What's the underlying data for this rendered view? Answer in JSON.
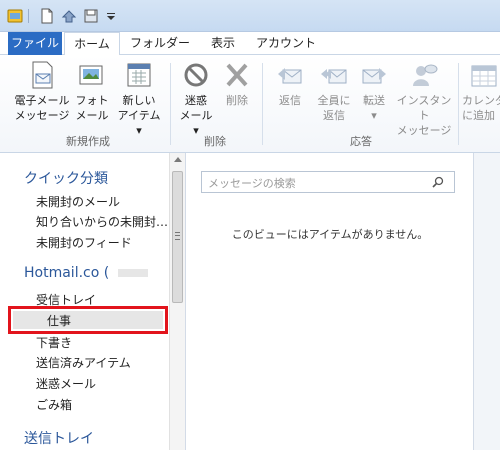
{
  "tabs": [
    {
      "id": "file",
      "label": "ファイル"
    },
    {
      "id": "home",
      "label": "ホーム"
    },
    {
      "id": "folder",
      "label": "フォルダー"
    },
    {
      "id": "view",
      "label": "表示"
    },
    {
      "id": "account",
      "label": "アカウント"
    }
  ],
  "ribbon": {
    "new_group": {
      "label": "新規作成",
      "email": "電子メール\nメッセージ",
      "photo": "フォト\nメール",
      "new_item": "新しい\nアイテム ▾"
    },
    "delete_group": {
      "label": "削除",
      "junk": "迷惑\nメール ▾",
      "delete": "削除"
    },
    "respond_group": {
      "label": "応答",
      "reply": "返信",
      "reply_all": "全員に\n返信",
      "forward": "転送\n▾",
      "instant": "インスタント\nメッセージ"
    },
    "calendar": "カレンダ\nに追加"
  },
  "nav": {
    "quick_views": {
      "heading": "クイック分類",
      "items": [
        "未開封のメール",
        "知り合いからの未開封…",
        "未開封のフィード"
      ]
    },
    "account": {
      "heading": "Hotmail.co (",
      "items": [
        "受信トレイ",
        "仕事",
        "下書き",
        "送信済みアイテム",
        "迷惑メール",
        "ごみ箱"
      ]
    },
    "outbox_heading": "送信トレイ"
  },
  "list": {
    "search_placeholder": "メッセージの検索",
    "empty_message": "このビューにはアイテムがありません。"
  }
}
